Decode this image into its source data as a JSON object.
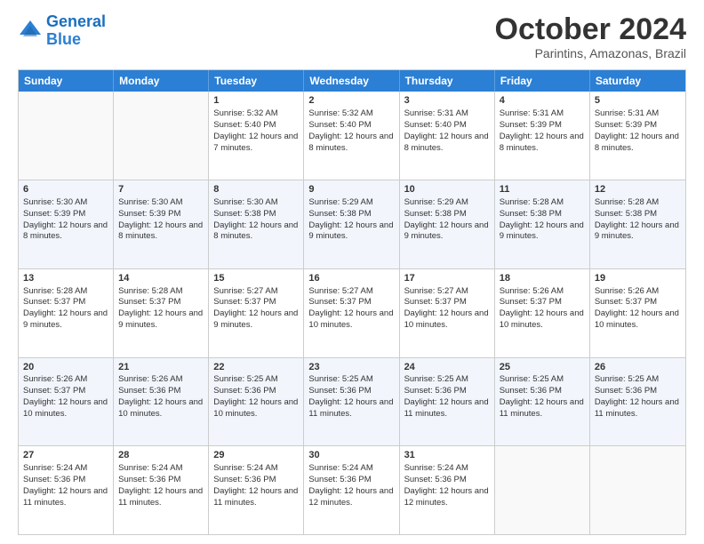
{
  "logo": {
    "line1": "General",
    "line2": "Blue"
  },
  "title": "October 2024",
  "location": "Parintins, Amazonas, Brazil",
  "days_of_week": [
    "Sunday",
    "Monday",
    "Tuesday",
    "Wednesday",
    "Thursday",
    "Friday",
    "Saturday"
  ],
  "weeks": [
    [
      {
        "day": "",
        "sunrise": "",
        "sunset": "",
        "daylight": ""
      },
      {
        "day": "",
        "sunrise": "",
        "sunset": "",
        "daylight": ""
      },
      {
        "day": "1",
        "sunrise": "Sunrise: 5:32 AM",
        "sunset": "Sunset: 5:40 PM",
        "daylight": "Daylight: 12 hours and 7 minutes."
      },
      {
        "day": "2",
        "sunrise": "Sunrise: 5:32 AM",
        "sunset": "Sunset: 5:40 PM",
        "daylight": "Daylight: 12 hours and 8 minutes."
      },
      {
        "day": "3",
        "sunrise": "Sunrise: 5:31 AM",
        "sunset": "Sunset: 5:40 PM",
        "daylight": "Daylight: 12 hours and 8 minutes."
      },
      {
        "day": "4",
        "sunrise": "Sunrise: 5:31 AM",
        "sunset": "Sunset: 5:39 PM",
        "daylight": "Daylight: 12 hours and 8 minutes."
      },
      {
        "day": "5",
        "sunrise": "Sunrise: 5:31 AM",
        "sunset": "Sunset: 5:39 PM",
        "daylight": "Daylight: 12 hours and 8 minutes."
      }
    ],
    [
      {
        "day": "6",
        "sunrise": "Sunrise: 5:30 AM",
        "sunset": "Sunset: 5:39 PM",
        "daylight": "Daylight: 12 hours and 8 minutes."
      },
      {
        "day": "7",
        "sunrise": "Sunrise: 5:30 AM",
        "sunset": "Sunset: 5:39 PM",
        "daylight": "Daylight: 12 hours and 8 minutes."
      },
      {
        "day": "8",
        "sunrise": "Sunrise: 5:30 AM",
        "sunset": "Sunset: 5:38 PM",
        "daylight": "Daylight: 12 hours and 8 minutes."
      },
      {
        "day": "9",
        "sunrise": "Sunrise: 5:29 AM",
        "sunset": "Sunset: 5:38 PM",
        "daylight": "Daylight: 12 hours and 9 minutes."
      },
      {
        "day": "10",
        "sunrise": "Sunrise: 5:29 AM",
        "sunset": "Sunset: 5:38 PM",
        "daylight": "Daylight: 12 hours and 9 minutes."
      },
      {
        "day": "11",
        "sunrise": "Sunrise: 5:28 AM",
        "sunset": "Sunset: 5:38 PM",
        "daylight": "Daylight: 12 hours and 9 minutes."
      },
      {
        "day": "12",
        "sunrise": "Sunrise: 5:28 AM",
        "sunset": "Sunset: 5:38 PM",
        "daylight": "Daylight: 12 hours and 9 minutes."
      }
    ],
    [
      {
        "day": "13",
        "sunrise": "Sunrise: 5:28 AM",
        "sunset": "Sunset: 5:37 PM",
        "daylight": "Daylight: 12 hours and 9 minutes."
      },
      {
        "day": "14",
        "sunrise": "Sunrise: 5:28 AM",
        "sunset": "Sunset: 5:37 PM",
        "daylight": "Daylight: 12 hours and 9 minutes."
      },
      {
        "day": "15",
        "sunrise": "Sunrise: 5:27 AM",
        "sunset": "Sunset: 5:37 PM",
        "daylight": "Daylight: 12 hours and 9 minutes."
      },
      {
        "day": "16",
        "sunrise": "Sunrise: 5:27 AM",
        "sunset": "Sunset: 5:37 PM",
        "daylight": "Daylight: 12 hours and 10 minutes."
      },
      {
        "day": "17",
        "sunrise": "Sunrise: 5:27 AM",
        "sunset": "Sunset: 5:37 PM",
        "daylight": "Daylight: 12 hours and 10 minutes."
      },
      {
        "day": "18",
        "sunrise": "Sunrise: 5:26 AM",
        "sunset": "Sunset: 5:37 PM",
        "daylight": "Daylight: 12 hours and 10 minutes."
      },
      {
        "day": "19",
        "sunrise": "Sunrise: 5:26 AM",
        "sunset": "Sunset: 5:37 PM",
        "daylight": "Daylight: 12 hours and 10 minutes."
      }
    ],
    [
      {
        "day": "20",
        "sunrise": "Sunrise: 5:26 AM",
        "sunset": "Sunset: 5:37 PM",
        "daylight": "Daylight: 12 hours and 10 minutes."
      },
      {
        "day": "21",
        "sunrise": "Sunrise: 5:26 AM",
        "sunset": "Sunset: 5:36 PM",
        "daylight": "Daylight: 12 hours and 10 minutes."
      },
      {
        "day": "22",
        "sunrise": "Sunrise: 5:25 AM",
        "sunset": "Sunset: 5:36 PM",
        "daylight": "Daylight: 12 hours and 10 minutes."
      },
      {
        "day": "23",
        "sunrise": "Sunrise: 5:25 AM",
        "sunset": "Sunset: 5:36 PM",
        "daylight": "Daylight: 12 hours and 11 minutes."
      },
      {
        "day": "24",
        "sunrise": "Sunrise: 5:25 AM",
        "sunset": "Sunset: 5:36 PM",
        "daylight": "Daylight: 12 hours and 11 minutes."
      },
      {
        "day": "25",
        "sunrise": "Sunrise: 5:25 AM",
        "sunset": "Sunset: 5:36 PM",
        "daylight": "Daylight: 12 hours and 11 minutes."
      },
      {
        "day": "26",
        "sunrise": "Sunrise: 5:25 AM",
        "sunset": "Sunset: 5:36 PM",
        "daylight": "Daylight: 12 hours and 11 minutes."
      }
    ],
    [
      {
        "day": "27",
        "sunrise": "Sunrise: 5:24 AM",
        "sunset": "Sunset: 5:36 PM",
        "daylight": "Daylight: 12 hours and 11 minutes."
      },
      {
        "day": "28",
        "sunrise": "Sunrise: 5:24 AM",
        "sunset": "Sunset: 5:36 PM",
        "daylight": "Daylight: 12 hours and 11 minutes."
      },
      {
        "day": "29",
        "sunrise": "Sunrise: 5:24 AM",
        "sunset": "Sunset: 5:36 PM",
        "daylight": "Daylight: 12 hours and 11 minutes."
      },
      {
        "day": "30",
        "sunrise": "Sunrise: 5:24 AM",
        "sunset": "Sunset: 5:36 PM",
        "daylight": "Daylight: 12 hours and 12 minutes."
      },
      {
        "day": "31",
        "sunrise": "Sunrise: 5:24 AM",
        "sunset": "Sunset: 5:36 PM",
        "daylight": "Daylight: 12 hours and 12 minutes."
      },
      {
        "day": "",
        "sunrise": "",
        "sunset": "",
        "daylight": ""
      },
      {
        "day": "",
        "sunrise": "",
        "sunset": "",
        "daylight": ""
      }
    ]
  ]
}
